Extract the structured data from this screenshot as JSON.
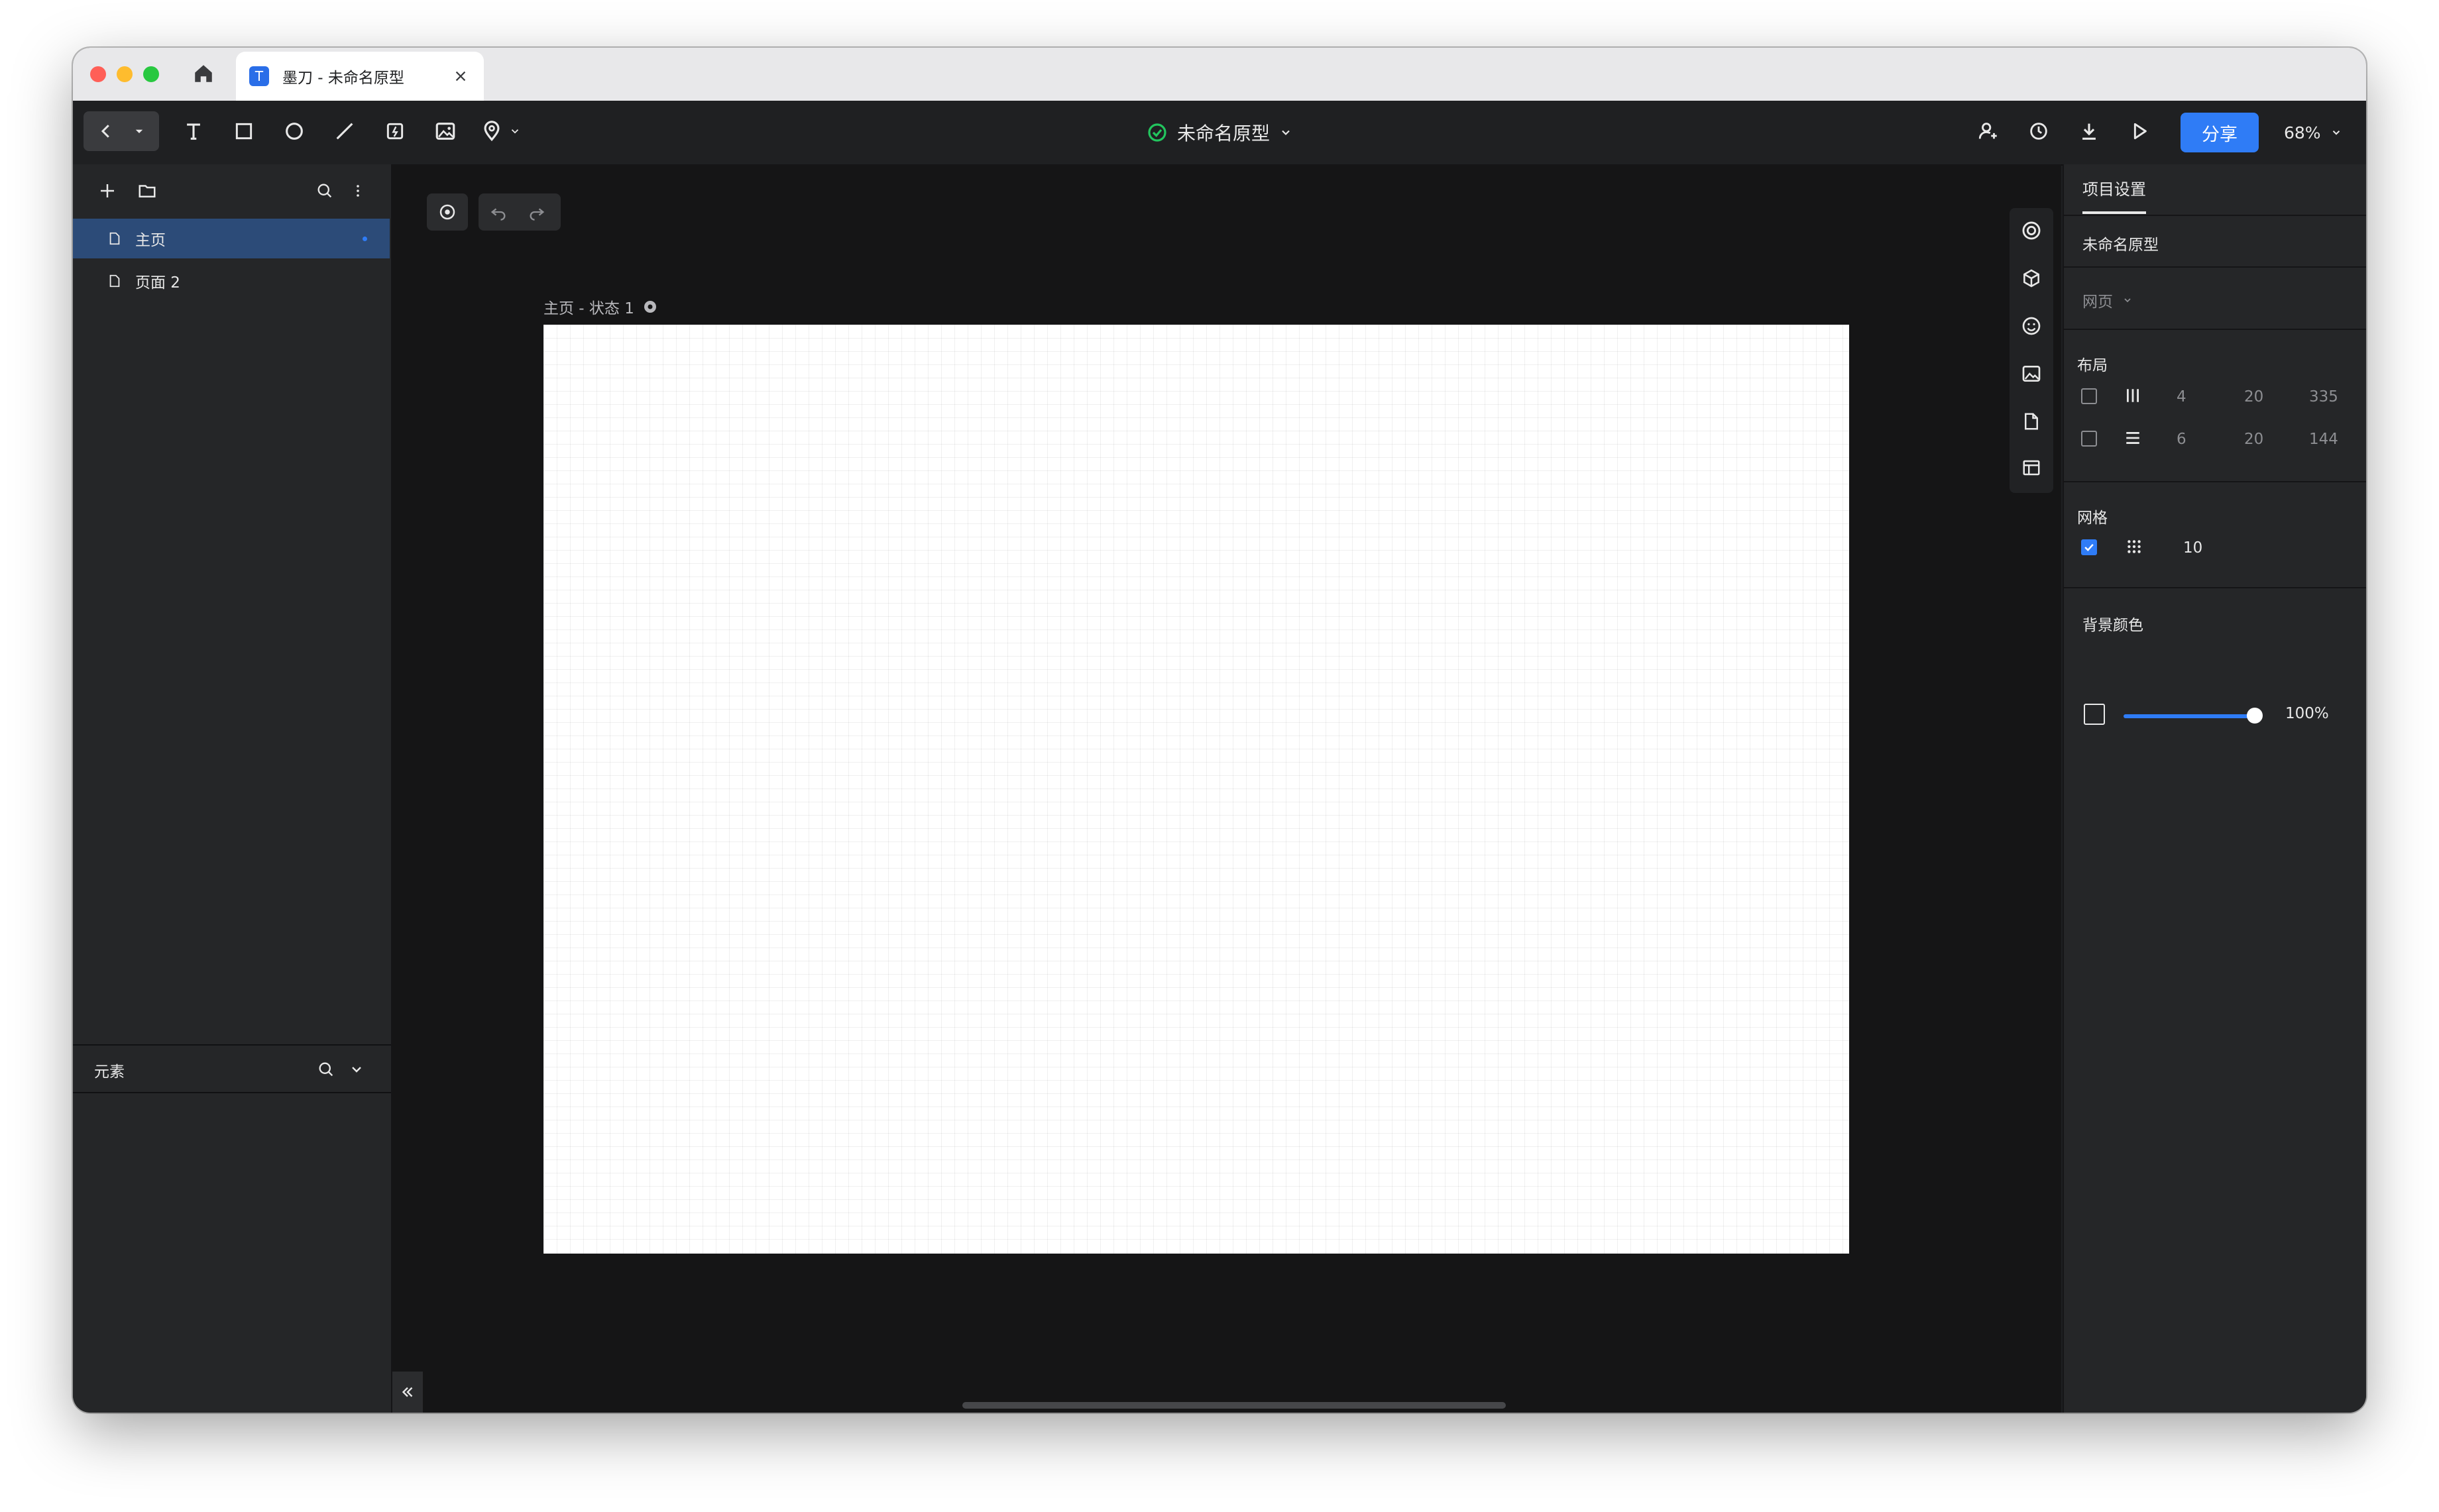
{
  "browser": {
    "tab_title": "墨刀 - 未命名原型",
    "tab_icon_text": "T"
  },
  "toolbar": {
    "doc_title": "未命名原型",
    "share_label": "分享",
    "zoom": "68%",
    "tools": [
      "back-icon",
      "dropdown-icon",
      "text-tool-icon",
      "rectangle-tool-icon",
      "ellipse-tool-icon",
      "line-tool-icon",
      "component-tool-icon",
      "image-tool-icon",
      "pin-tool-icon"
    ],
    "right_actions": [
      "add-collaborator-icon",
      "history-icon",
      "download-icon",
      "play-icon"
    ]
  },
  "pages": {
    "items": [
      {
        "label": "主页",
        "active": true
      },
      {
        "label": "页面 2",
        "active": false
      }
    ]
  },
  "elements": {
    "label": "元素"
  },
  "canvas": {
    "artboard_label": "主页 - 状态 1",
    "help": "?"
  },
  "panel": {
    "tab": "项目设置",
    "project_name": "未命名原型",
    "device": "网页",
    "layout_title": "布局",
    "layout_cols": {
      "count": "4",
      "gutter": "20",
      "width": "335"
    },
    "layout_rows": {
      "count": "6",
      "gutter": "20",
      "height": "144"
    },
    "grid_title": "网格",
    "grid_size": "10",
    "bg_title": "背景颜色",
    "bg_opacity": "100%",
    "bg_opacity_value": 100,
    "grid_enabled": true
  },
  "colors": {
    "accent": "#2f7cf6",
    "toolbar_bg": "#1f2022",
    "canvas_bg": "#151516",
    "status_ok": "#22c55e"
  }
}
